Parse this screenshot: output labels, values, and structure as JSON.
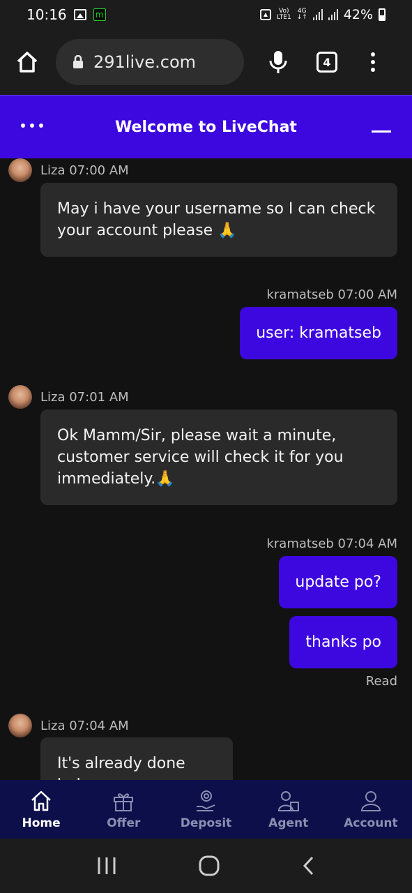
{
  "status_bar": {
    "time": "10:16",
    "network_top": "Vo)",
    "network_bottom": "LTE1",
    "net_type_top": "4G",
    "net_type_bottom": "↓↑",
    "battery": "42%"
  },
  "browser": {
    "url": "291live.com",
    "tab_count": "4"
  },
  "chat_header": {
    "title": "Welcome to LiveChat"
  },
  "messages": [
    {
      "meta": "Liza 07:00 AM",
      "text": "May i have your username so I can check your account please 🙏"
    },
    {
      "meta": "kramatseb 07:00 AM",
      "text": "user: kramatseb"
    },
    {
      "meta": "Liza 07:01 AM",
      "text": "Ok Mamm/Sir, please wait a minute, customer service will check it for you immediately.🙏"
    },
    {
      "meta": "kramatseb 07:04 AM",
      "text": "update po?"
    },
    {
      "text": "thanks po"
    },
    {
      "status": "Read"
    },
    {
      "meta": "Liza 07:04 AM",
      "text": "It's already done lods"
    }
  ],
  "bottom_nav": [
    {
      "label": "Home",
      "icon": "home-icon",
      "active": true
    },
    {
      "label": "Offer",
      "icon": "gift-icon"
    },
    {
      "label": "Deposit",
      "icon": "deposit-icon"
    },
    {
      "label": "Agent",
      "icon": "agent-icon"
    },
    {
      "label": "Account",
      "icon": "account-icon"
    }
  ],
  "colors": {
    "accent": "#3d08e0",
    "nav_bg": "#0d0f4a",
    "bg": "#121212",
    "agent_bubble": "#2a2a2a"
  }
}
